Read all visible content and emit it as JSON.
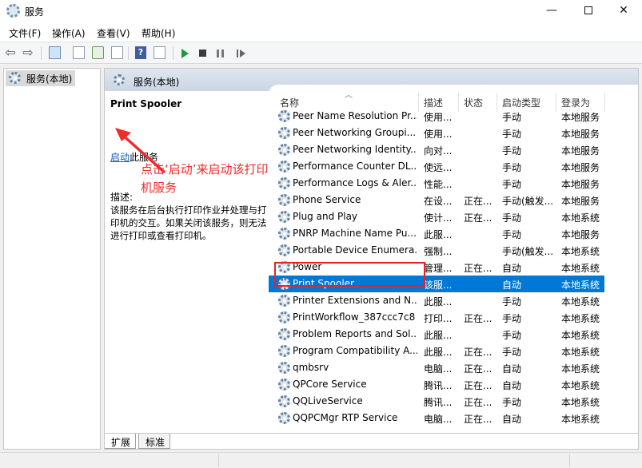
{
  "window": {
    "title": "服务",
    "minimize": "—",
    "close": "✕"
  },
  "menu": [
    "文件(F)",
    "操作(A)",
    "查看(V)",
    "帮助(H)"
  ],
  "toolbar_icons": [
    "back-icon",
    "forward-icon",
    "console-tree-icon",
    "view-icon",
    "refresh-icon",
    "export-icon",
    "help-icon",
    "properties-icon",
    "start-icon",
    "stop-icon",
    "pause-icon",
    "restart-icon"
  ],
  "tree": {
    "root": "服务(本地)"
  },
  "panel": {
    "title": "服务(本地)"
  },
  "detail": {
    "service_name": "Print Spooler",
    "start_link": "启动",
    "start_suffix": "此服务",
    "desc_label": "描述:",
    "desc_text": "该服务在后台执行打印作业并处理与打印机的交互。如果关闭该服务，则无法进行打印或查看打印机。"
  },
  "columns": {
    "name": "名称",
    "desc": "描述",
    "state": "状态",
    "start": "启动类型",
    "logon": "登录为"
  },
  "services": [
    {
      "name": "Peer Name Resolution Pr...",
      "desc": "使用...",
      "state": "",
      "start": "手动",
      "logon": "本地服务"
    },
    {
      "name": "Peer Networking Groupi...",
      "desc": "使用...",
      "state": "",
      "start": "手动",
      "logon": "本地服务"
    },
    {
      "name": "Peer Networking Identity...",
      "desc": "向对...",
      "state": "",
      "start": "手动",
      "logon": "本地服务"
    },
    {
      "name": "Performance Counter DL...",
      "desc": "使远...",
      "state": "",
      "start": "手动",
      "logon": "本地服务"
    },
    {
      "name": "Performance Logs & Aler...",
      "desc": "性能...",
      "state": "",
      "start": "手动",
      "logon": "本地服务"
    },
    {
      "name": "Phone Service",
      "desc": "在设...",
      "state": "正在...",
      "start": "手动(触发...",
      "logon": "本地服务"
    },
    {
      "name": "Plug and Play",
      "desc": "使计...",
      "state": "正在...",
      "start": "手动",
      "logon": "本地系统"
    },
    {
      "name": "PNRP Machine Name Pu...",
      "desc": "此服...",
      "state": "",
      "start": "手动",
      "logon": "本地服务"
    },
    {
      "name": "Portable Device Enumera...",
      "desc": "强制...",
      "state": "",
      "start": "手动(触发...",
      "logon": "本地系统"
    },
    {
      "name": "Power",
      "desc": "管理...",
      "state": "正在...",
      "start": "自动",
      "logon": "本地系统"
    },
    {
      "name": "Print Spooler",
      "desc": "该服...",
      "state": "",
      "start": "自动",
      "logon": "本地系统"
    },
    {
      "name": "Printer Extensions and N...",
      "desc": "此服...",
      "state": "",
      "start": "手动",
      "logon": "本地系统"
    },
    {
      "name": "PrintWorkflow_387ccc7c8",
      "desc": "打印...",
      "state": "正在...",
      "start": "手动",
      "logon": "本地系统"
    },
    {
      "name": "Problem Reports and Sol...",
      "desc": "此服...",
      "state": "",
      "start": "手动",
      "logon": "本地系统"
    },
    {
      "name": "Program Compatibility A...",
      "desc": "此服...",
      "state": "正在...",
      "start": "手动",
      "logon": "本地系统"
    },
    {
      "name": "qmbsrv",
      "desc": "电脑...",
      "state": "正在...",
      "start": "自动",
      "logon": "本地系统"
    },
    {
      "name": "QPCore Service",
      "desc": "腾讯...",
      "state": "正在...",
      "start": "自动",
      "logon": "本地系统"
    },
    {
      "name": "QQLiveService",
      "desc": "腾讯...",
      "state": "正在...",
      "start": "手动",
      "logon": "本地系统"
    },
    {
      "name": "QQPCMgr RTP Service",
      "desc": "电脑...",
      "state": "正在...",
      "start": "自动",
      "logon": "本地系统"
    }
  ],
  "selected_service": "Print Spooler",
  "tabs": [
    "扩展",
    "标准"
  ],
  "annotation": {
    "text": "点击‘启动’来启动该打印机服务",
    "color": "#ef2b2b"
  },
  "colors": {
    "selection": "#0078d7",
    "link": "#0b5fb8",
    "highlight_box": "#e42424"
  }
}
